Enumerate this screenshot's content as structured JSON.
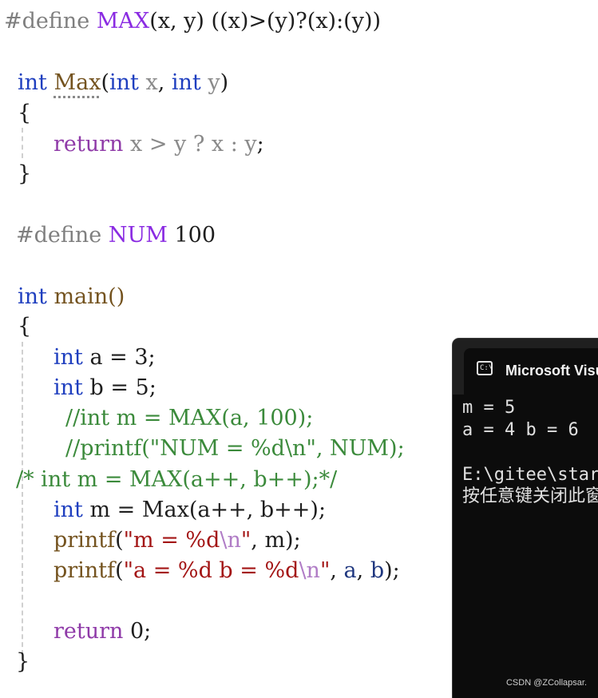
{
  "editor": {
    "lines": {
      "l1": {
        "define": "#define",
        "macro": "MAX",
        "params": "(x, y)",
        "body": " ((x)>(y)?(x):(y))"
      },
      "l2": {
        "type": "int",
        "fn": "Max",
        "open": "(",
        "t1": "int",
        "p1": " x",
        "comma": ", ",
        "t2": "int",
        "p2": " y",
        "close": ")"
      },
      "l3": {
        "text": "{"
      },
      "l4": {
        "ret": "return",
        "expr": " x > y ? x : y",
        "semi": ";"
      },
      "l5": {
        "text": "}"
      },
      "l6": {
        "define": "#define",
        "macro": "NUM",
        "value": " 100"
      },
      "l7": {
        "type": "int",
        "name": " main()"
      },
      "l8": {
        "text": "{"
      },
      "l9": {
        "type": "int",
        "rest": " a = 3;"
      },
      "l10": {
        "type": "int",
        "rest": " b = 5;"
      },
      "l11": {
        "text": "//int m = MAX(a, 100);"
      },
      "l12": {
        "text": "//printf(\"NUM = %d\\n\", NUM);"
      },
      "l13": {
        "text": "/* int m = MAX(a++, b++);*/"
      },
      "l14": {
        "type": "int",
        "rest1": " m = ",
        "fn": "Max",
        "rest2": "(a++, b++);"
      },
      "l15": {
        "fn": "printf",
        "open": "(",
        "str": "\"m = %d",
        "esc": "\\n",
        "strend": "\"",
        "rest": ", m);"
      },
      "l16": {
        "fn": "printf",
        "open": "(",
        "str": "\"a = %d b = %d",
        "esc": "\\n",
        "strend": "\"",
        "rest1": ", ",
        "a": "a",
        "rest2": ", ",
        "b": "b",
        "rest3": ");"
      },
      "l17": {
        "ret": "return",
        "rest": " 0;"
      },
      "l18": {
        "text": "}"
      }
    }
  },
  "console": {
    "title": "Microsoft Visual Studio 调试控制台",
    "icon": "cmd-terminal-icon",
    "icon_text": "C:\\",
    "output": [
      "m = 5",
      "a = 4 b = 6",
      "",
      "E:\\gitee\\star",
      "按任意键关闭此窗口"
    ]
  },
  "watermark": "CSDN @ZCollapsar.",
  "colors": {
    "keyword": "#1f3fbf",
    "control": "#8f3aa8",
    "macro": "#8a2be2",
    "comment": "#3b8a3b",
    "string": "#a31515",
    "console_bg": "#0c0c0c"
  }
}
